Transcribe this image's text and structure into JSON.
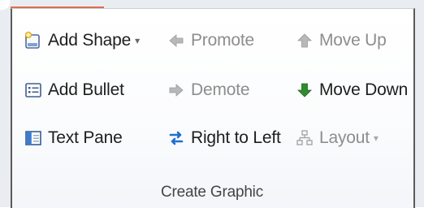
{
  "group": {
    "label": "Create Graphic"
  },
  "commands": {
    "add_shape": {
      "label": "Add Shape",
      "icon": "add-shape-icon",
      "dropdown": true
    },
    "promote": {
      "label": "Promote",
      "icon": "promote-arrow-icon",
      "disabled": true
    },
    "move_up": {
      "label": "Move Up",
      "icon": "move-up-arrow-icon",
      "disabled": true
    },
    "add_bullet": {
      "label": "Add Bullet",
      "icon": "add-bullet-icon"
    },
    "demote": {
      "label": "Demote",
      "icon": "demote-arrow-icon",
      "disabled": true
    },
    "move_down": {
      "label": "Move Down",
      "icon": "move-down-arrow-icon"
    },
    "text_pane": {
      "label": "Text Pane",
      "icon": "text-pane-icon"
    },
    "right_to_left": {
      "label": "Right to Left",
      "icon": "right-to-left-icon"
    },
    "layout": {
      "label": "Layout",
      "icon": "layout-icon",
      "dropdown": true,
      "disabled": true
    }
  },
  "colors": {
    "accent_tab": "#d8704a",
    "enabled_text": "#1e1e1e",
    "disabled_text": "#8d8d8d",
    "move_down_arrow": "#2e8b2e"
  }
}
